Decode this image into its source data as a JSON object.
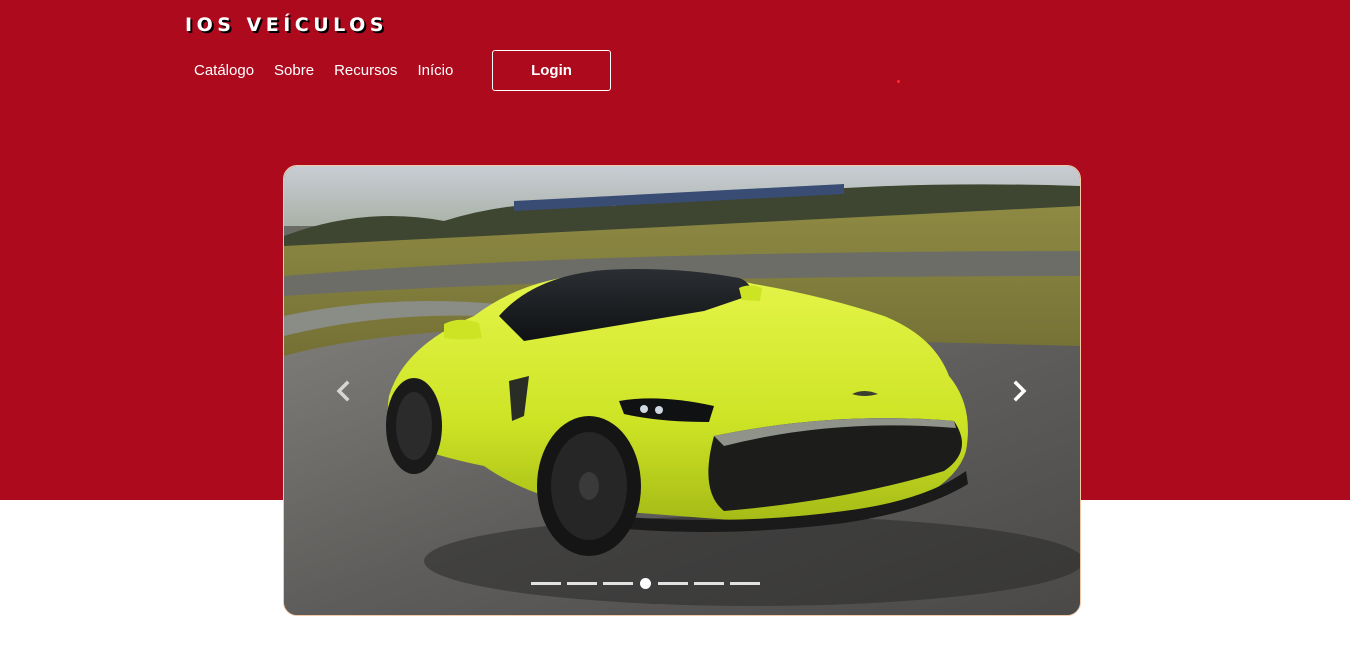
{
  "header": {
    "brand": "IOS VEÍCULOS",
    "login_label": "Login"
  },
  "nav": {
    "items": [
      {
        "label": "Catálogo"
      },
      {
        "label": "Sobre"
      },
      {
        "label": "Recursos"
      },
      {
        "label": "Início"
      }
    ]
  },
  "carousel": {
    "slide_count": 7,
    "active_index": 3,
    "prev_icon": "chevron-left-icon",
    "next_icon": "chevron-right-icon",
    "image_subject": "car-photo"
  },
  "colors": {
    "hero_red": "#ad0a1d",
    "car_body": "#d4ec2a",
    "carousel_border": "#f3c9a8"
  }
}
